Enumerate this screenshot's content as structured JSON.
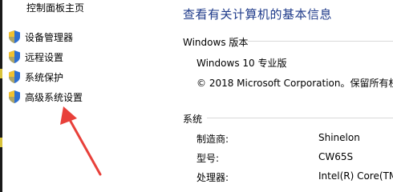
{
  "left_nav": {
    "control_panel_home": "控制面板主页",
    "items": [
      {
        "label": "设备管理器",
        "icon": "shield-icon"
      },
      {
        "label": "远程设置",
        "icon": "shield-icon"
      },
      {
        "label": "系统保护",
        "icon": "shield-icon"
      },
      {
        "label": "高级系统设置",
        "icon": "shield-icon"
      }
    ]
  },
  "main": {
    "title": "查看有关计算机的基本信息",
    "windows_edition": {
      "heading": "Windows 版本",
      "edition": "Windows 10 专业版",
      "copyright": "© 2018 Microsoft Corporation。保留所有权"
    },
    "system": {
      "heading": "系统",
      "rows": [
        {
          "label": "制造商:",
          "value": "Shinelon"
        },
        {
          "label": "型号:",
          "value": "CW65S"
        },
        {
          "label": "处理器:",
          "value": "Intel(R) Core(TM"
        }
      ]
    }
  },
  "colors": {
    "title": "#1e3a8a",
    "annotation_arrow": "#e8403a",
    "shield_blue": "#2f6fd0",
    "shield_yellow": "#f2c12e"
  }
}
